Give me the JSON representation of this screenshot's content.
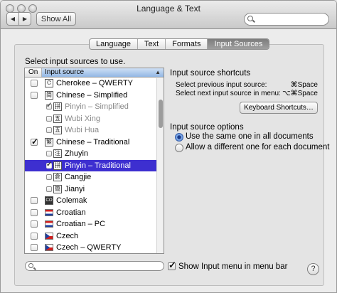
{
  "window": {
    "title": "Language & Text"
  },
  "toolbar": {
    "back_label": "◀",
    "forward_label": "▶",
    "show_all_label": "Show All",
    "search_placeholder": ""
  },
  "tabs": [
    {
      "label": "Language"
    },
    {
      "label": "Text"
    },
    {
      "label": "Formats"
    },
    {
      "label": "Input Sources"
    }
  ],
  "left": {
    "heading": "Select input sources to use.",
    "col_on": "On",
    "col_source": "Input source",
    "items": [
      {
        "label": "Cherokee – QWERTY",
        "icon": "Ꮳ"
      },
      {
        "label": "Chinese – Simplified",
        "icon": "简"
      },
      {
        "label": "Pinyin – Simplified",
        "icon": "拼"
      },
      {
        "label": "Wubi Xing",
        "icon": "五"
      },
      {
        "label": "Wubi Hua",
        "icon": "五"
      },
      {
        "label": "Chinese – Traditional",
        "icon": "繁"
      },
      {
        "label": "Zhuyin",
        "icon": "注"
      },
      {
        "label": "Pinyin – Traditional",
        "icon": "拼"
      },
      {
        "label": "Cangjie",
        "icon": "倉"
      },
      {
        "label": "Jianyi",
        "icon": "簡"
      },
      {
        "label": "Colemak",
        "icon": "CO"
      },
      {
        "label": "Croatian",
        "icon": "hr-flag"
      },
      {
        "label": "Croatian – PC",
        "icon": "hr-flag"
      },
      {
        "label": "Czech",
        "icon": "cz-flag"
      },
      {
        "label": "Czech – QWERTY",
        "icon": "cz-flag"
      }
    ]
  },
  "shortcuts": {
    "heading": "Input source shortcuts",
    "prev_label": "Select previous input source:",
    "prev_key": "⌘Space",
    "next_label": "Select next input source in menu:",
    "next_key": "⌥⌘Space",
    "button_label": "Keyboard Shortcuts…"
  },
  "options": {
    "heading": "Input source options",
    "radio1": "Use the same one in all documents",
    "radio2": "Allow a different one for each document"
  },
  "bottom": {
    "search_value": "",
    "menu_label": "Show Input menu in menu bar",
    "help_label": "?"
  },
  "colors": {
    "selection": "#3d2fd0",
    "tab_active": "#8a8a8a"
  }
}
